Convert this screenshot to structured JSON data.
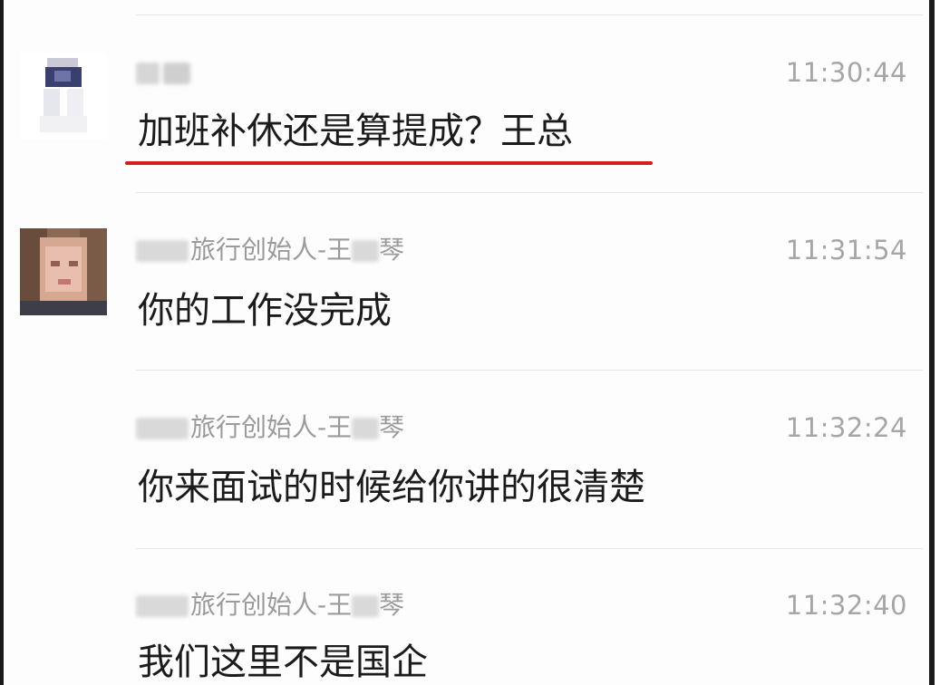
{
  "messages": [
    {
      "sender": "",
      "time": "11:30:44",
      "text": "加班补休还是算提成？王总",
      "highlighted": true
    },
    {
      "sender_prefix": "",
      "sender_a": "旅行创始人-王",
      "sender_b": "琴",
      "time": "11:31:54",
      "text": "你的工作没完成"
    },
    {
      "sender_prefix": "",
      "sender_a": "旅行创始人-王",
      "sender_b": "琴",
      "time": "11:32:24",
      "text": "你来面试的时候给你讲的很清楚"
    },
    {
      "sender_prefix": "",
      "sender_a": "旅行创始人-王",
      "sender_b": "琴",
      "time": "11:32:40",
      "text": "我们这里不是国企"
    }
  ],
  "colors": {
    "highlight_underline": "#d51f1f",
    "timestamp": "#a6a6a6",
    "sender": "#9b9b9b",
    "message": "#1b1b1b"
  },
  "icons": [
    "avatar-blurred-employee",
    "avatar-blurred-founder"
  ]
}
